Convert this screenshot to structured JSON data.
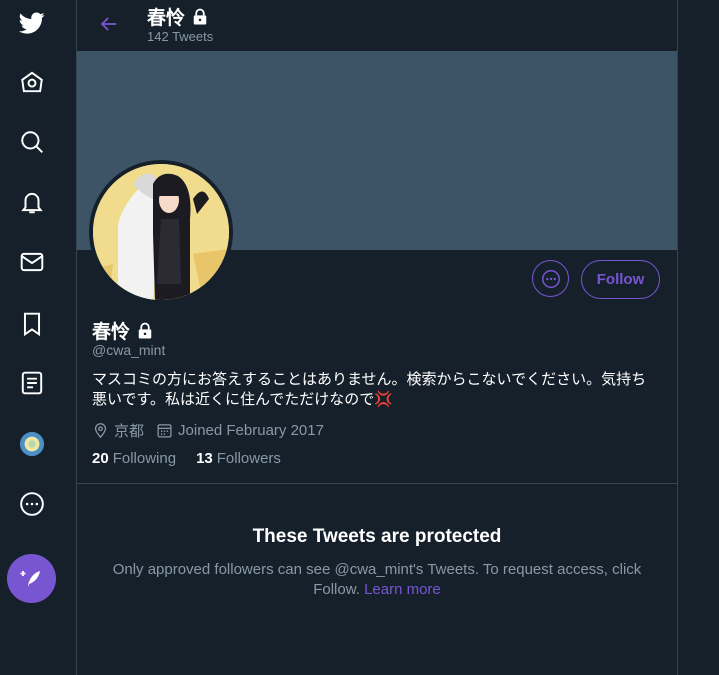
{
  "colors": {
    "accent": "#7856d2",
    "background": "#15202b",
    "banner": "#3d5466",
    "muted": "#8899a6",
    "border": "#38444d"
  },
  "sidebar": {
    "items": [
      {
        "icon": "twitter-logo-icon"
      },
      {
        "icon": "home-icon"
      },
      {
        "icon": "search-icon"
      },
      {
        "icon": "notifications-bell-icon"
      },
      {
        "icon": "messages-envelope-icon"
      },
      {
        "icon": "bookmark-icon"
      },
      {
        "icon": "lists-icon"
      },
      {
        "icon": "profile-avatar-icon"
      },
      {
        "icon": "more-circle-icon"
      },
      {
        "icon": "compose-tweet-icon"
      }
    ]
  },
  "header": {
    "name": "春怜",
    "tweet_count": "142 Tweets"
  },
  "profile": {
    "name": "春怜",
    "handle": "@cwa_mint",
    "bio": "マスコミの方にお答えすることはありません。検索からこないでください。気持ち悪いです。私は近くに住んでただけなので💢",
    "location": "京都",
    "joined": "Joined February 2017",
    "following_count": "20",
    "following_label": "Following",
    "followers_count": "13",
    "followers_label": "Followers",
    "follow_button": "Follow"
  },
  "protected": {
    "title": "These Tweets are protected",
    "text": "Only approved followers can see @cwa_mint's Tweets. To request access, click Follow.",
    "link": "Learn more"
  }
}
